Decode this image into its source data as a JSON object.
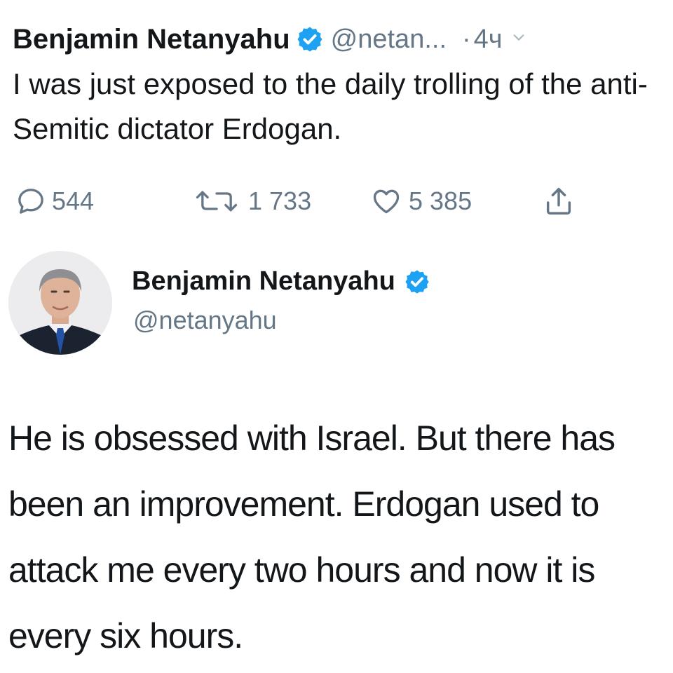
{
  "tweet": {
    "author_name": "Benjamin Netanyahu",
    "handle": "@netan...",
    "separator": "·",
    "time": "4ч",
    "text": "I was just exposed to the daily trolling of the anti-Semitic dictator Erdogan.",
    "actions": {
      "replies": "544",
      "retweets": "1 733",
      "likes": "5 385"
    },
    "icons": [
      "verified-badge-icon",
      "chevron-down-icon",
      "reply-icon",
      "retweet-icon",
      "like-icon",
      "share-icon"
    ]
  },
  "quoted_tweet": {
    "author_name": "Benjamin Netanyahu",
    "handle": "@netanyahu",
    "text": "He is obsessed with Israel. But there has been an improvement. Erdogan used to attack me every two hours and now it is every six hours."
  },
  "colors": {
    "text_primary": "#14171a",
    "text_secondary": "#657786",
    "verified_blue": "#1da1f2"
  }
}
